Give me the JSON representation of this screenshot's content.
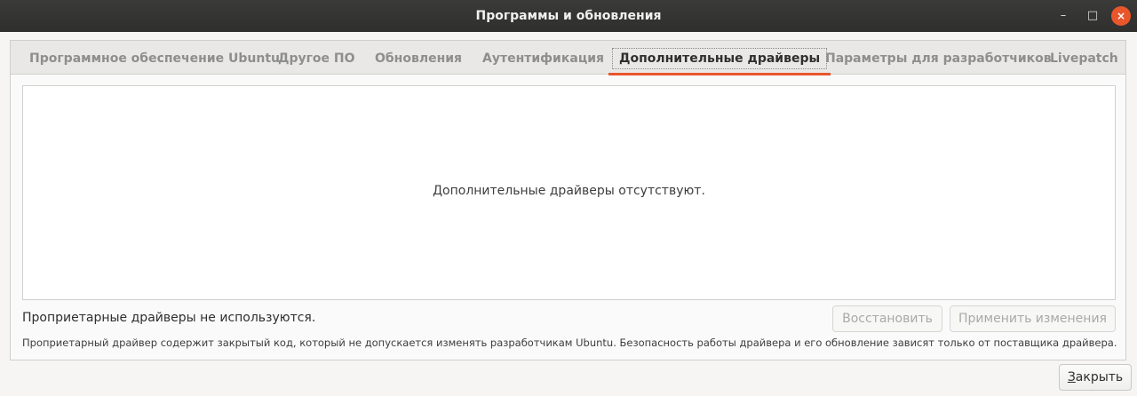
{
  "window": {
    "title": "Программы и обновления",
    "controls": {
      "minimize": "–",
      "maximize": "□",
      "close": "×"
    }
  },
  "tabs": [
    {
      "label": "Программное обеспечение Ubuntu",
      "active": false
    },
    {
      "label": "Другое ПО",
      "active": false
    },
    {
      "label": "Обновления",
      "active": false
    },
    {
      "label": "Аутентификация",
      "active": false
    },
    {
      "label": "Дополнительные драйверы",
      "active": true
    },
    {
      "label": "Параметры для разработчиков",
      "active": false
    },
    {
      "label": "Livepatch",
      "active": false
    }
  ],
  "drivers": {
    "empty_message": "Дополнительные драйверы отсутствуют.",
    "status": "Проприетарные драйверы не используются.",
    "footnote": "Проприетарный драйвер содержит закрытый код, который не допускается изменять разработчикам Ubuntu. Безопасность работы драйвера и его обновление зависят только от поставщика драйвера."
  },
  "buttons": {
    "restore": "Восстановить",
    "apply": "Применить изменения",
    "close_mnemonic": "З",
    "close_rest": "акрыть"
  },
  "colors": {
    "accent": "#e9562c",
    "titlebar": "#2f2f2d"
  }
}
